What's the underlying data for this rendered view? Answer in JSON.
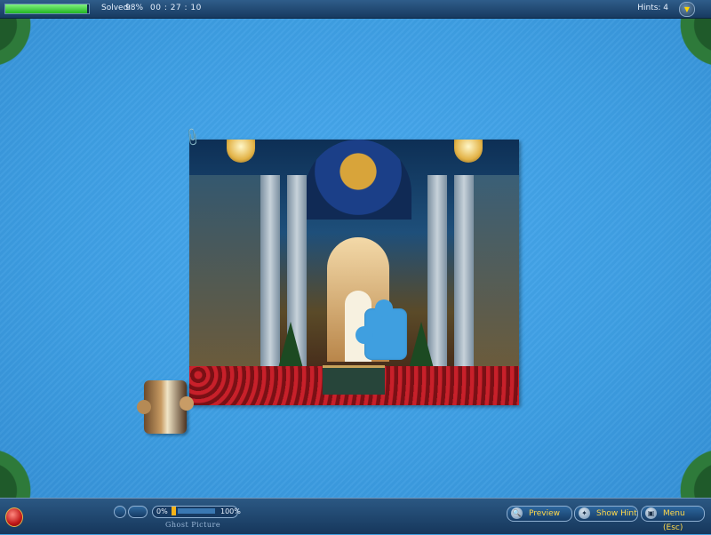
{
  "topbar": {
    "progress_percent": 98,
    "solved_label": "Solved:",
    "solved_value": "98%",
    "timer": "00 : 27 : 10",
    "hints_text": "Hints: 4",
    "hint_toggle_glyph": "▼"
  },
  "board": {
    "image_subject": "cathedral-interior-christmas",
    "pieces_remaining_on_board": 1
  },
  "bottombar": {
    "ghost_min": "0%",
    "ghost_max": "100%",
    "ghost_label": "Ghost Picture",
    "ghost_value_percent": 10,
    "preview_label": "Preview",
    "show_hint_label": "Show Hint",
    "menu_label": "Menu (Esc)"
  },
  "icons": {
    "preview": "magnifier-icon",
    "hint": "wand-icon",
    "menu": "monitor-icon",
    "ornament": "christmas-ornament-icon",
    "clip": "paperclip-icon"
  },
  "colors": {
    "background": "#3f9fe0",
    "bar": "#1f4670",
    "accent_text": "#ffd84a",
    "progress": "#2bd42b"
  }
}
